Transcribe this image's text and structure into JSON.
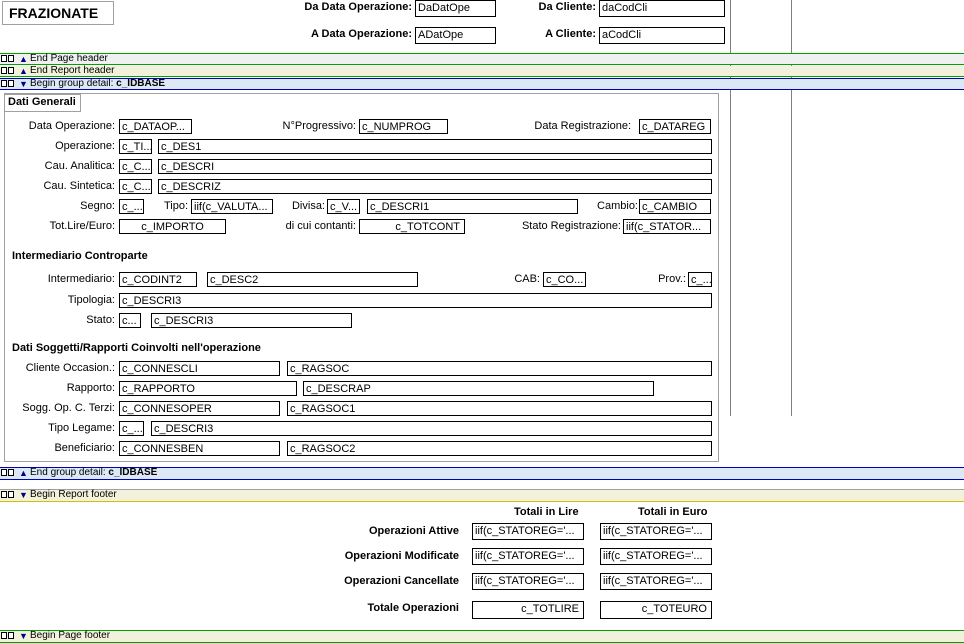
{
  "header": {
    "title": "FRAZIONATE",
    "da_data_label": "Da Data Operazione:",
    "da_data_value": "DaDatOpe",
    "a_data_label": "A Data Operazione:",
    "a_data_value": "ADatOpe",
    "da_cliente_label": "Da Cliente:",
    "da_cliente_value": "daCodCli",
    "a_cliente_label": "A Cliente:",
    "a_cliente_value": "aCodCli"
  },
  "bands": {
    "end_page_header": "End Page header",
    "end_report_header": "End Report header",
    "begin_group_prefix": "Begin group detail: ",
    "begin_group_name": "c_IDBASE",
    "end_group_prefix": "End group detail: ",
    "end_group_name": "c_IDBASE",
    "begin_report_footer": "Begin Report footer",
    "begin_page_footer": "Begin Page footer"
  },
  "detail": {
    "dati_generali_title": "Dati Generali",
    "data_operazione_label": "Data Operazione:",
    "data_operazione_field": "c_DATAOP...",
    "nprogressivo_label": "N°Progressivo:",
    "nprogressivo_field": "c_NUMPROG",
    "data_registrazione_label": "Data Registrazione:",
    "data_registrazione_field": "c_DATAREG",
    "operazione_label": "Operazione:",
    "operazione_code": "c_TI...",
    "operazione_desc": "c_DES1",
    "cau_analitica_label": "Cau. Analitica:",
    "cau_analitica_code": "c_C...",
    "cau_analitica_desc": "c_DESCRI",
    "cau_sintetica_label": "Cau. Sintetica:",
    "cau_sintetica_code": "c_C...",
    "cau_sintetica_desc": "c_DESCRIZ",
    "segno_label": "Segno:",
    "segno_field": "c_...",
    "tipo_label": "Tipo:",
    "tipo_field": "iif(c_VALUTA...",
    "divisa_label": "Divisa:",
    "divisa_code": "c_V...",
    "divisa_desc": "c_DESCRI1",
    "cambio_label": "Cambio:",
    "cambio_field": "c_CAMBIO",
    "totlire_label": "Tot.Lire/Euro:",
    "totlire_field": "c_IMPORTO",
    "contanti_label": "di cui contanti:",
    "contanti_field": "c_TOTCONT",
    "stato_reg_label": "Stato Registrazione:",
    "stato_reg_field": "iif(c_STATOR...",
    "intermediario_title": "Intermediario Controparte",
    "intermediario_label": "Intermediario:",
    "intermediario_code": "c_CODINT2",
    "intermediario_desc": "c_DESC2",
    "cab_label": "CAB:",
    "cab_field": "c_CO...",
    "prov_label": "Prov.:",
    "prov_field": "c_...",
    "tipologia_label": "Tipologia:",
    "tipologia_field": "c_DESCRI3",
    "stato_label": "Stato:",
    "stato_code": "c...",
    "stato_desc": "c_DESCRI3",
    "soggetti_title": "Dati Soggetti/Rapporti Coinvolti nell'operazione",
    "cliente_occ_label": "Cliente Occasion.:",
    "cliente_occ_code": "c_CONNESCLI",
    "cliente_occ_desc": "c_RAGSOC",
    "rapporto_label": "Rapporto:",
    "rapporto_code": "c_RAPPORTO",
    "rapporto_desc": "c_DESCRAP",
    "sogg_terzi_label": "Sogg. Op. C. Terzi:",
    "sogg_terzi_code": "c_CONNESOPER",
    "sogg_terzi_desc": "c_RAGSOC1",
    "tipo_legame_label": "Tipo Legame:",
    "tipo_legame_code": "c_...",
    "tipo_legame_desc": "c_DESCRI3",
    "beneficiario_label": "Beneficiario:",
    "beneficiario_code": "c_CONNESBEN",
    "beneficiario_desc": "c_RAGSOC2"
  },
  "footer": {
    "totali_lire_header": "Totali in Lire",
    "totali_euro_header": "Totali in Euro",
    "attive_label": "Operazioni Attive",
    "attive_lire": "iif(c_STATOREG='...",
    "attive_euro": "iif(c_STATOREG='...",
    "modificate_label": "Operazioni Modificate",
    "modificate_lire": "iif(c_STATOREG='...",
    "modificate_euro": "iif(c_STATOREG='...",
    "cancellate_label": "Operazioni Cancellate",
    "cancellate_lire": "iif(c_STATOREG='...",
    "cancellate_euro": "iif(c_STATOREG='...",
    "totale_label": "Totale Operazioni",
    "totale_lire": "c_TOTLIRE",
    "totale_euro": "c_TOTEURO"
  },
  "colors": {
    "band_green_line": "#00a000",
    "band_blue_line": "#0000c0",
    "band_fill_light": "#f0f0f0",
    "band_fill_group": "#dce8f4",
    "band_fill_footer": "#f2f2dc",
    "arrow": "#00008b"
  }
}
